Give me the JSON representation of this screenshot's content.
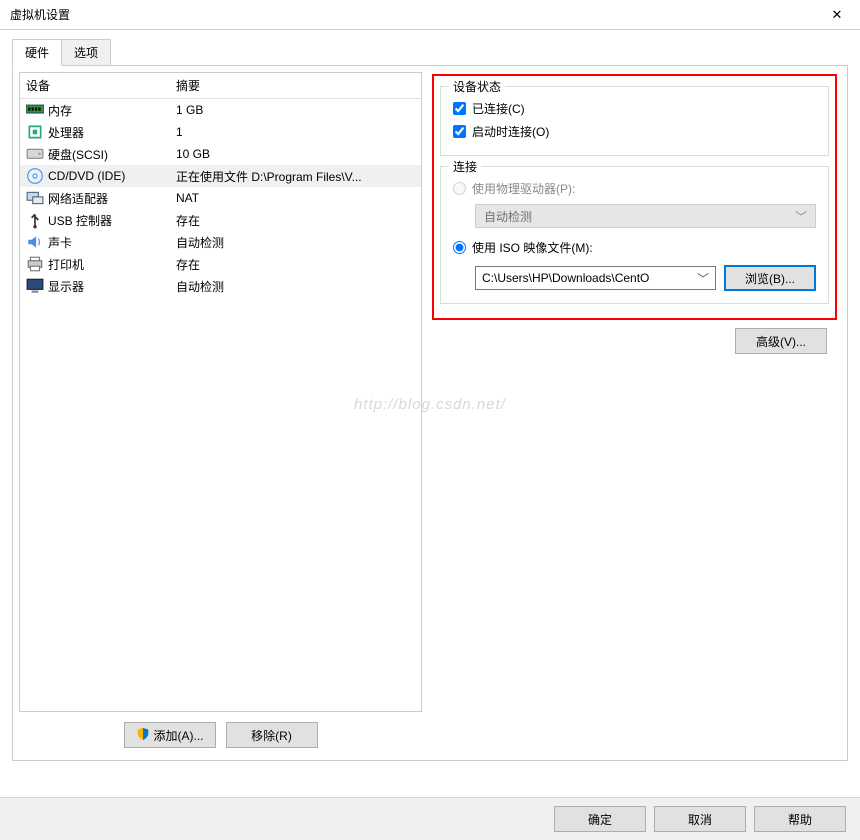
{
  "window": {
    "title": "虚拟机设置"
  },
  "tabs": {
    "hardware": "硬件",
    "options": "选项"
  },
  "list": {
    "header_device": "设备",
    "header_summary": "摘要",
    "items": [
      {
        "label": "内存",
        "summary": "1 GB"
      },
      {
        "label": "处理器",
        "summary": "1"
      },
      {
        "label": "硬盘(SCSI)",
        "summary": "10 GB"
      },
      {
        "label": "CD/DVD (IDE)",
        "summary": "正在使用文件 D:\\Program Files\\V..."
      },
      {
        "label": "网络适配器",
        "summary": "NAT"
      },
      {
        "label": "USB 控制器",
        "summary": "存在"
      },
      {
        "label": "声卡",
        "summary": "自动检测"
      },
      {
        "label": "打印机",
        "summary": "存在"
      },
      {
        "label": "显示器",
        "summary": "自动检测"
      }
    ]
  },
  "left_buttons": {
    "add": "添加(A)...",
    "remove": "移除(R)"
  },
  "status_box": {
    "title": "设备状态",
    "connected": "已连接(C)",
    "connect_on_start": "启动时连接(O)"
  },
  "connect_box": {
    "title": "连接",
    "use_physical": "使用物理驱动器(P):",
    "auto_detect": "自动检测",
    "use_iso": "使用 ISO 映像文件(M):",
    "iso_path": "C:\\Users\\HP\\Downloads\\CentO",
    "browse": "浏览(B)..."
  },
  "advanced": "高级(V)...",
  "watermark": "http://blog.csdn.net/",
  "footer": {
    "ok": "确定",
    "cancel": "取消",
    "help": "帮助"
  }
}
